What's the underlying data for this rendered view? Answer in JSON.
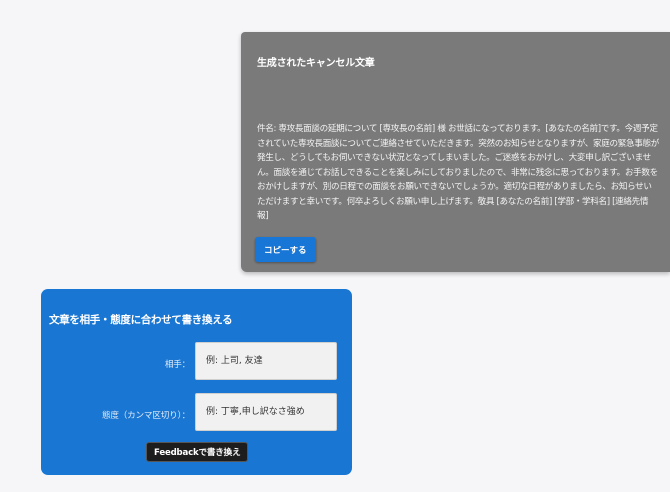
{
  "result": {
    "title": "生成されたキャンセル文章",
    "body": "件名: 専攻長面談の延期について [専攻長の名前] 様 お世話になっております。[あなたの名前]です。今週予定されていた専攻長面談についてご連絡させていただきます。突然のお知らせとなりますが、家庭の緊急事態が発生し、どうしてもお伺いできない状況となってしまいました。ご迷惑をおかけし、大変申し訳ございません。面談を通じてお話しできることを楽しみにしておりましたので、非常に残念に思っております。お手数をおかけしますが、別の日程での面談をお願いできないでしょうか。適切な日程がありましたら、お知らせいただけますと幸いです。何卒よろしくお願い申し上げます。敬具 [あなたの名前] [学部・学科名] [連絡先情報]",
    "copy_label": "コピーする"
  },
  "rewrite": {
    "title": "文章を相手・態度に合わせて書き換える",
    "partner_label": "相手：",
    "partner_placeholder": "例: 上司, 友達",
    "attitude_label": "態度（カンマ区切り）：",
    "attitude_placeholder": "例: 丁寧,申し訳なさ強め",
    "feedback_label": "Feedbackで書き換え"
  },
  "colors": {
    "result_panel_bg": "#7a7a7a",
    "rewrite_panel_bg": "#1976d2",
    "copy_button_bg": "#1877d6",
    "feedback_button_bg": "#1d1d1d",
    "page_bg": "#f6f6f8"
  }
}
